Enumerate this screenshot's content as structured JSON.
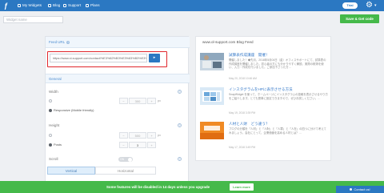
{
  "topbar": {
    "nav": [
      "My Widgets",
      "Blog",
      "Support",
      "Plans"
    ],
    "trial_label": "Trial",
    "gear_glyph": "⚙",
    "caret_glyph": "▾"
  },
  "widget_name": {
    "placeholder": "Widget name"
  },
  "save_button": "Save & Get code",
  "feed": {
    "heading": "Feed URL",
    "url": "https://www.ol-support.com/contact/%E3%82%B3%E3%83%B3%E3%83",
    "btn_glyph": "▸"
  },
  "general": {
    "heading": "General",
    "width_label": "Width",
    "width_manual": "",
    "width_value": "300",
    "width_unit": "px",
    "width_responsive": "Responsive (Mobile friendly)",
    "height_label": "Height",
    "height_manual": "",
    "height_value": "500",
    "height_unit": "px",
    "height_posts": "Posts",
    "height_posts_value": "3",
    "scroll_label": "Scroll",
    "scroll_toggle": "ON",
    "vertical_label": "Vertical",
    "horizontal_label": "Horizontal",
    "help_glyph": "?"
  },
  "preview": {
    "title": "www.ol-support.com Blog Feed",
    "items": [
      {
        "title": "試算表作成講座　開催！",
        "text": "開催しました！◆先月、2018年5月04日（金）オフィスサポートにて、試算表の作成講座を開催しました。初心者の方にも分かりやすく解説。実際の帳簿を使い、入力・作成を行いました。ご参加下さった方…",
        "date": "May 20, 2018 10:46 AM"
      },
      {
        "title": "インスタグラムをHPに表示させる方法",
        "text": "SnapWidget を使って、ホームページにインスタグラムの投稿を表示させるやり方をご紹介します。とても簡単に設定できますので、ぜひお試しください。…",
        "date": "May 19, 2018 3:39 PM"
      },
      {
        "title": "人材と人財　どう違う？",
        "text": "ブログの分類を「人材」と「人財」と「人罪」と「人在」の四つに分けて考えてみましょう。会社にとって、企業価値を高める人材とは？…",
        "date": "May 17, 2018 3:49 PM"
      }
    ]
  },
  "bottom": {
    "message": "Some features will be disabled in 14 days unless you upgrade",
    "learn_label": "Learn more",
    "contact_label": "Contact us!"
  },
  "colors": {
    "brand_blue": "#2b78c2",
    "save_green": "#45b94a",
    "highlight_red": "#e0262c"
  },
  "icons": {
    "logo": "widget-logo-icon",
    "nav_my_widgets": "widgets-icon",
    "nav_blog": "blog-icon",
    "nav_support": "support-icon",
    "nav_plans": "plans-icon",
    "settings": "gear-icon"
  }
}
